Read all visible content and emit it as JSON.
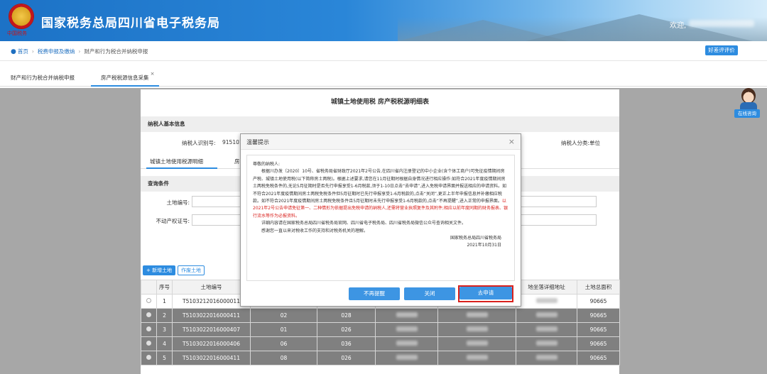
{
  "header": {
    "title": "国家税务总局四川省电子税务局",
    "logo_text": "中国税务",
    "welcome": "欢迎,"
  },
  "breadcrumb": {
    "items": [
      "首页",
      "税费申报及缴纳",
      "财产和行为税合并纳税申报"
    ],
    "rate_button": "好差评评价"
  },
  "tabs": [
    {
      "label": "财产和行为税合并纳税申报"
    },
    {
      "label": "房产税税源信息采集",
      "close": "×"
    }
  ],
  "panel": {
    "title": "城镇土地使用税 房产税税源明细表",
    "section_basic": "纳税人基本信息",
    "taxpayer_id_label": "纳税人识别号:",
    "taxpayer_id_value": "915101",
    "taxpayer_type": "纳税人分类:单位",
    "subtab1": "城镇土地使用税源明细",
    "subtab2": "房",
    "section_query": "查询条件",
    "q_land_no": "土地编号:",
    "q_property_no": "不动产权证号:",
    "btn_add": "+ 新增土地",
    "btn_void": "作废土地"
  },
  "table": {
    "headers": [
      "",
      "序号",
      "土地编号",
      "",
      "",
      "",
      "",
      "地坐落详细地址",
      "土地总面积"
    ],
    "rows": [
      {
        "seq": "1",
        "land_no": "T5103212016000011",
        "c3": "",
        "c4": "",
        "area": "90665"
      },
      {
        "seq": "2",
        "land_no": "T5103022016000411",
        "c3": "02",
        "c4": "028",
        "area": "90665"
      },
      {
        "seq": "3",
        "land_no": "T5103022016000407",
        "c3": "01",
        "c4": "026",
        "area": "90665"
      },
      {
        "seq": "4",
        "land_no": "T5103022016000406",
        "c3": "06",
        "c4": "036",
        "area": "90665"
      },
      {
        "seq": "5",
        "land_no": "T5103022016000411",
        "c3": "08",
        "c4": "026",
        "area": "90665"
      }
    ]
  },
  "assistant": {
    "label": "在线咨询"
  },
  "modal": {
    "title": "温馨提示",
    "close": "×",
    "greeting": "尊敬的纳税人:",
    "p1": "根据川办发〔2020〕10号、省税务局省财政厅2021年2号公告,在四川省内注册登记的中小企业(含个体工商户)可免征疫情期间房产税、城镇土地使用税(以下简称房土两税)。根据上述要求,请您在11月征期时根据自身情况进行相应操作:如符合2021年度疫情期间房土两税免税条件的,无论5月征期时是否先行申报享受1-6月税款,须于1-10日点击“去申请”,进入免税申请界面并报送相应的申请资料。如不符合2021年度疫情期间房土两税免税条件但5月征期时已先行申报享受1-6月税款的,点击“关闭”,更正上半年申报信息并补缴相应税款。如不符合2021年度疫情期间房土两税免税条件且5月征期时未先行申报享受1-6月税款的,点击“不再提醒”,进入正常的申报界面。",
    "p1_red": "以2021年2号公告申请免征第一、二种情形为依据提出免税申请的纳税人,还需将营业执照复件及其附件;相应以前年度同期的财务报表、银行流水等作为必报资料。",
    "p2": "详细内容请在国家税务总局四川省税务局官网、四川省电子税务局、四川省税务局微信公众号查询相关文件。",
    "p3": "感谢您一直以来对税收工作的支持和对税务机关的理解。",
    "sign1": "国家税务总局四川省税务局",
    "sign2": "2021年10月31日",
    "btn_dismiss": "不再提醒",
    "btn_close": "关闭",
    "btn_apply": "去申请"
  },
  "colors": {
    "accent": "#2d8ce0",
    "highlight": "#d9201c"
  }
}
